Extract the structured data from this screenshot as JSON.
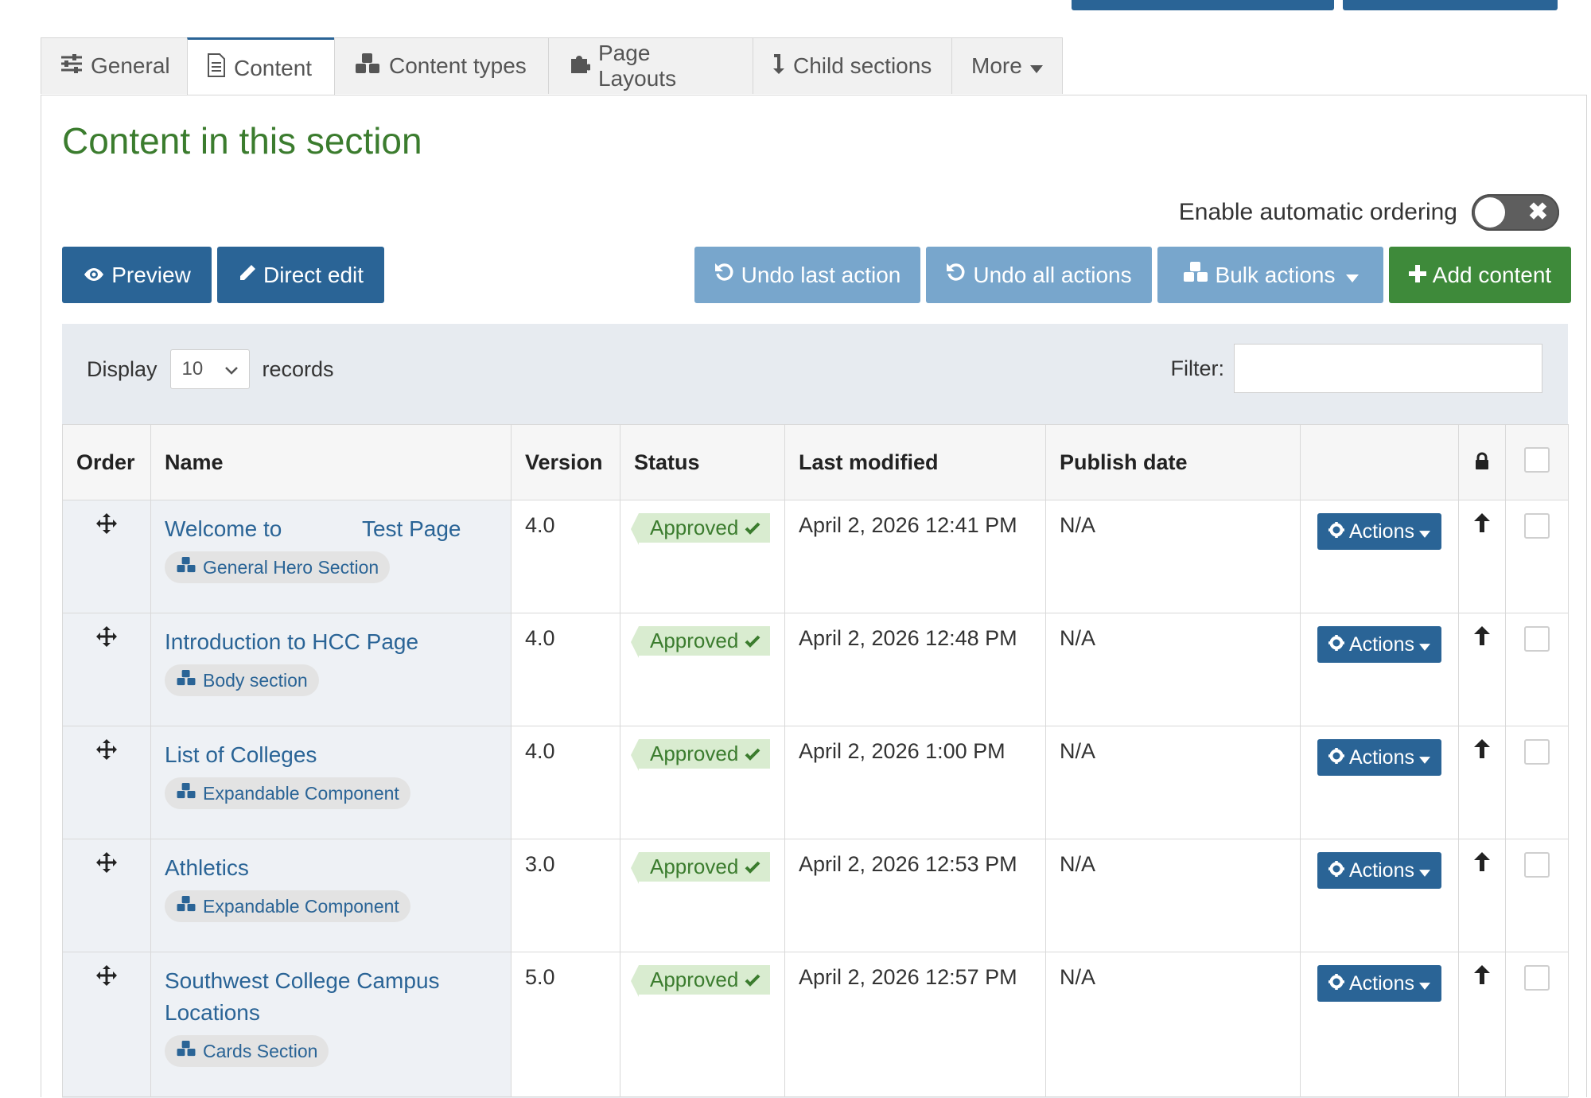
{
  "tabs": [
    {
      "label": "General",
      "icon": "sliders-icon"
    },
    {
      "label": "Content",
      "icon": "document-icon",
      "active": true
    },
    {
      "label": "Content types",
      "icon": "cubes-icon"
    },
    {
      "label": "Page Layouts",
      "icon": "puzzle-icon"
    },
    {
      "label": "Child sections",
      "icon": "level-down-icon"
    },
    {
      "label": "More",
      "icon": "caret-down-icon"
    }
  ],
  "heading": "Content in this section",
  "auto_ordering": {
    "label": "Enable automatic ordering",
    "enabled": false,
    "off_symbol": "✖"
  },
  "toolbar": {
    "preview": "Preview",
    "direct_edit": "Direct edit",
    "undo_last": "Undo last action",
    "undo_all": "Undo all actions",
    "bulk_actions": "Bulk actions",
    "add_content": "Add content"
  },
  "display": {
    "label": "Display",
    "value": "10",
    "suffix": "records"
  },
  "filter": {
    "label": "Filter:",
    "value": ""
  },
  "columns": [
    "Order",
    "Name",
    "Version",
    "Status",
    "Last modified",
    "Publish date",
    "",
    "lock-icon",
    "checkbox"
  ],
  "rows": [
    {
      "name": "Welcome to             Test Page",
      "type": "General Hero Section",
      "version": "4.0",
      "status": "Approved",
      "modified": "April 2, 2026 12:41 PM",
      "publish": "N/A",
      "action": "Actions"
    },
    {
      "name": "Introduction to HCC Page",
      "type": "Body section",
      "version": "4.0",
      "status": "Approved",
      "modified": "April 2, 2026 12:48 PM",
      "publish": "N/A",
      "action": "Actions"
    },
    {
      "name": "List of Colleges",
      "type": "Expandable Component",
      "version": "4.0",
      "status": "Approved",
      "modified": "April 2, 2026 1:00 PM",
      "publish": "N/A",
      "action": "Actions"
    },
    {
      "name": "Athletics",
      "type": "Expandable Component",
      "version": "3.0",
      "status": "Approved",
      "modified": "April 2, 2026 12:53 PM",
      "publish": "N/A",
      "action": "Actions"
    },
    {
      "name": "Southwest College Campus Locations",
      "type": "Cards Section",
      "version": "5.0",
      "status": "Approved",
      "modified": "April 2, 2026 12:57 PM",
      "publish": "N/A",
      "action": "Actions"
    }
  ],
  "colors": {
    "primary": "#2a6496",
    "primary_light": "#78a6cc",
    "success": "#3e8a3a",
    "heading": "#3b7c2e",
    "status_bg": "#d9ecd0"
  }
}
